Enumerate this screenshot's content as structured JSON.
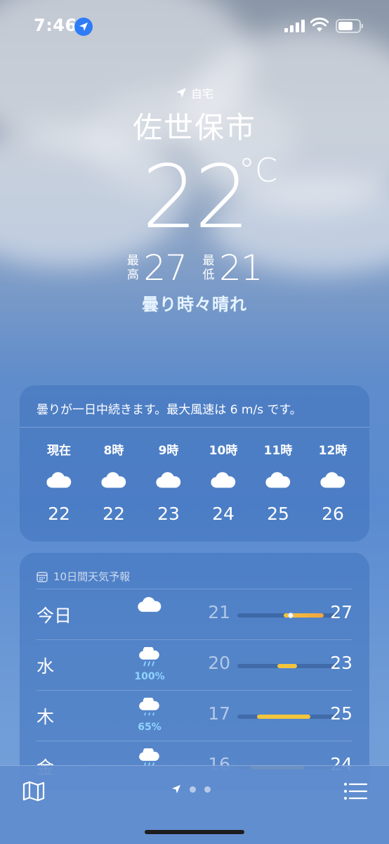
{
  "status_bar": {
    "time": "7:46"
  },
  "header": {
    "location_tag": "自宅",
    "city": "佐世保市",
    "temperature": "22",
    "unit": "°C",
    "high_label": "最高",
    "high": "27",
    "low_label": "最低",
    "low": "21",
    "condition": "曇り時々晴れ"
  },
  "hourly": {
    "summary": "曇りが一日中続きます。最大風速は 6 m/s です。",
    "hours": [
      {
        "label": "現在",
        "icon": "cloud-icon",
        "temp": "22"
      },
      {
        "label": "8時",
        "icon": "cloud-icon",
        "temp": "22"
      },
      {
        "label": "9時",
        "icon": "cloud-icon",
        "temp": "23"
      },
      {
        "label": "10時",
        "icon": "cloud-icon",
        "temp": "24"
      },
      {
        "label": "11時",
        "icon": "cloud-icon",
        "temp": "25"
      },
      {
        "label": "12時",
        "icon": "cloud-icon",
        "temp": "26"
      }
    ]
  },
  "daily": {
    "title": "10日間天気予報",
    "days": [
      {
        "day": "今日",
        "icon": "cloud-icon",
        "precip": "",
        "low": "21",
        "high": "27"
      },
      {
        "day": "水",
        "icon": "cloud-rain-icon",
        "precip": "100%",
        "low": "20",
        "high": "23"
      },
      {
        "day": "木",
        "icon": "cloud-drizzle-icon",
        "precip": "65%",
        "low": "17",
        "high": "25"
      },
      {
        "day": "金",
        "icon": "cloud-rain-icon",
        "precip": "",
        "low": "16",
        "high": "24"
      }
    ]
  },
  "colors": {
    "accent_blue": "#2f7cf6",
    "precip_text": "#8fd3ff",
    "bar_yellow": "#f3c53d",
    "bar_orange": "#f0a341"
  }
}
